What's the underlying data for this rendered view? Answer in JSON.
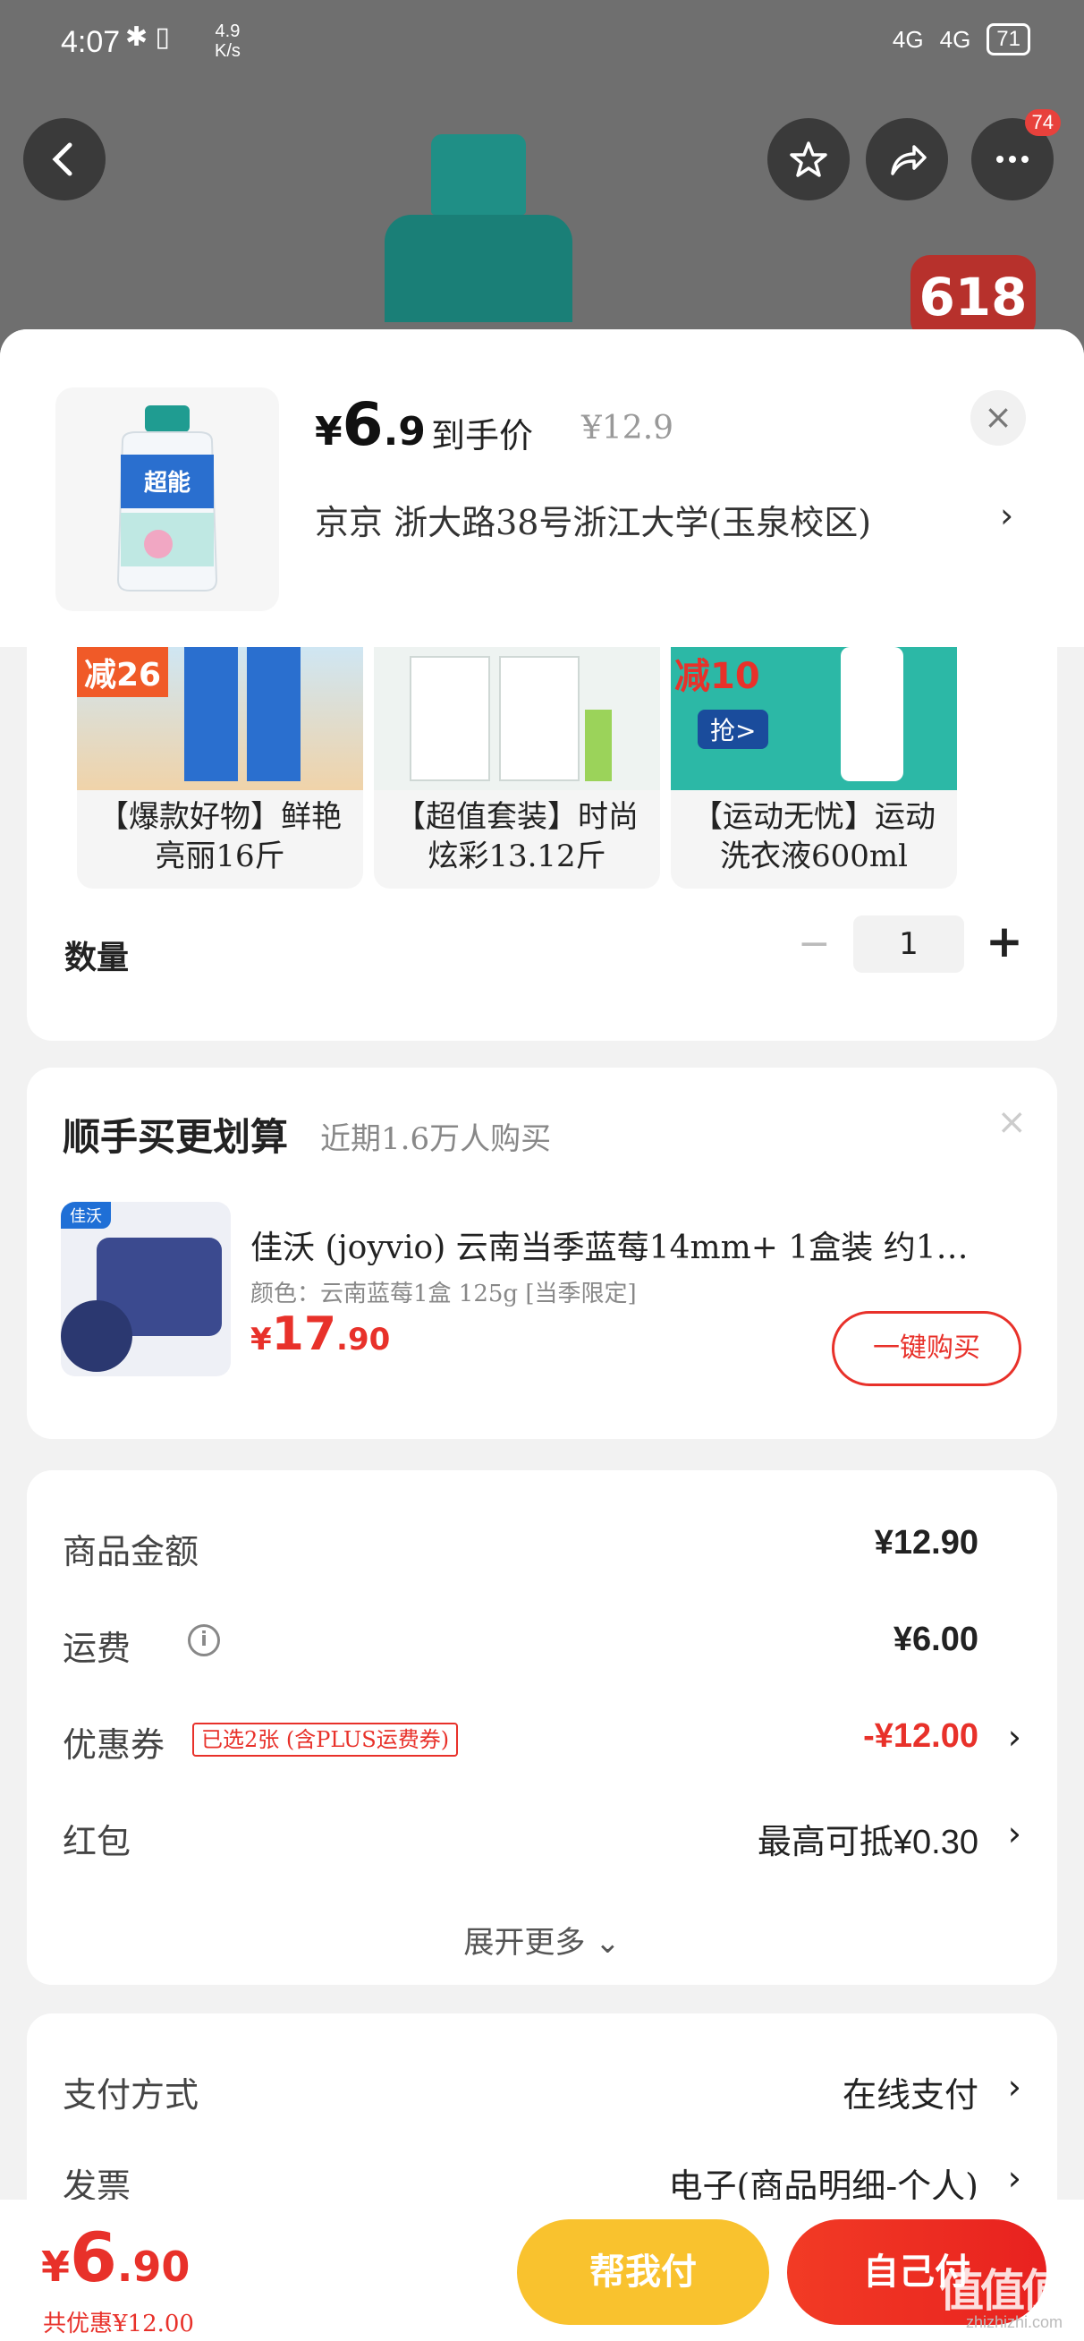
{
  "status_bar": {
    "time": "4:07",
    "speed_top": "4.9",
    "speed_bottom": "K/s",
    "signal1": "4G",
    "signal2": "4G",
    "battery": "71"
  },
  "top_nav": {
    "more_badge": "74",
    "promo_badge": "618"
  },
  "product": {
    "price_yen": "¥",
    "price_int": "6",
    "price_dec": ".9",
    "price_label": "到手价",
    "original_price": "¥12.9",
    "address": "京京 浙大路38号浙江大学(玉泉校区)",
    "thumb_brand": "超能"
  },
  "variants": [
    {
      "label": "【爆款好物】鲜艳亮丽16斤",
      "promo": "减26"
    },
    {
      "label": "【超值套装】时尚炫彩13.12斤",
      "promo": ""
    },
    {
      "label": "【运动无忧】运动洗衣液600ml",
      "promo": "减10",
      "cta": "抢>"
    }
  ],
  "quantity": {
    "label": "数量",
    "value": "1",
    "minus": "−",
    "plus": "+"
  },
  "upsell": {
    "title": "顺手买更划算",
    "subtitle": "近期1.6万人购买",
    "item_name": "佳沃 (joyvio) 云南当季蓝莓14mm+ 1盒装 约1…",
    "item_spec": "颜色：云南蓝莓1盒 125g [当季限定]",
    "price_yen": "¥",
    "price_int": "17",
    "price_dec": ".90",
    "buy_label": "一键购买",
    "brand_tag": "佳沃"
  },
  "summary": {
    "goods_label": "商品金额",
    "goods_value": "¥12.90",
    "shipping_label": "运费",
    "shipping_value": "¥6.00",
    "coupon_label": "优惠券",
    "coupon_tag": "已选2张 (含PLUS运费券)",
    "coupon_value": "-¥12.00",
    "redpacket_label": "红包",
    "redpacket_value": "最高可抵¥0.30",
    "expand_label": "展开更多"
  },
  "payment": {
    "method_label": "支付方式",
    "method_value": "在线支付",
    "invoice_label": "发票",
    "invoice_value": "电子(商品明细-个人)"
  },
  "bottom": {
    "total_yen": "¥",
    "total_int": "6",
    "total_dec": ".90",
    "saved": "共优惠¥12.00",
    "help_pay": "帮我付",
    "self_pay": "自己付"
  },
  "watermark": {
    "main": "值值值",
    "sub": "zhizhizhi.com"
  },
  "colors": {
    "accent_red": "#e8312a",
    "help_yellow": "#f9c22e",
    "brand_teal": "#1f8f86"
  }
}
